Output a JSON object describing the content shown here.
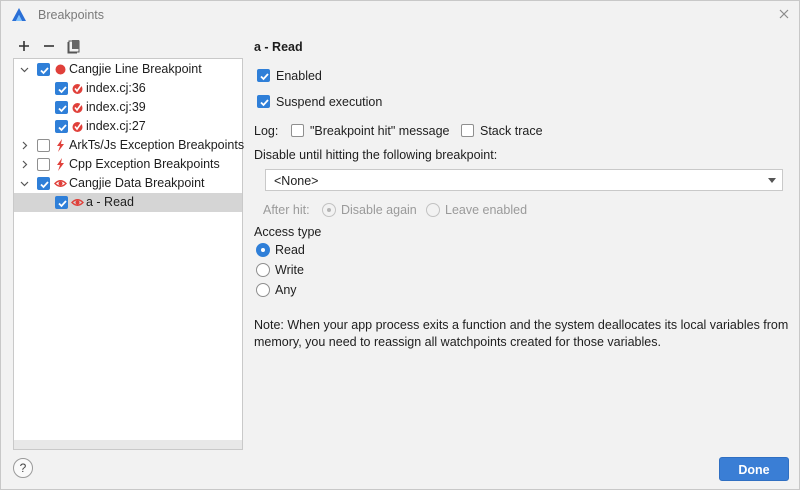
{
  "window": {
    "title": "Breakpoints",
    "logo_icon": "deveco-logo-icon",
    "close_icon": "close-icon"
  },
  "toolbar": {
    "add_icon": "plus-icon",
    "remove_icon": "minus-icon",
    "group_icon": "group-icon"
  },
  "tree": {
    "items": [
      {
        "label": "Cangjie Line Breakpoint",
        "checked": true,
        "icon": "red-dot-icon",
        "expanded": true
      },
      {
        "label": "index.cj:36",
        "checked": true,
        "icon": "line-breakpoint-icon"
      },
      {
        "label": "index.cj:39",
        "checked": true,
        "icon": "line-breakpoint-icon"
      },
      {
        "label": "index.cj:27",
        "checked": true,
        "icon": "line-breakpoint-icon"
      },
      {
        "label": "ArkTs/Js Exception Breakpoints",
        "checked": false,
        "icon": "lightning-icon",
        "expanded": false
      },
      {
        "label": "Cpp Exception Breakpoints",
        "checked": false,
        "icon": "lightning-icon",
        "expanded": false
      },
      {
        "label": "Cangjie Data Breakpoint",
        "checked": true,
        "icon": "eye-icon",
        "expanded": true
      },
      {
        "label": "a - Read",
        "checked": true,
        "icon": "eye-icon",
        "selected": true
      }
    ]
  },
  "detail": {
    "heading": "a - Read",
    "enabled_label": "Enabled",
    "enabled": true,
    "suspend_label": "Suspend execution",
    "suspend": true,
    "log_label": "Log:",
    "log_message_label": "\"Breakpoint hit\" message",
    "log_message": false,
    "stack_trace_label": "Stack trace",
    "stack_trace": false,
    "disable_until_label": "Disable until hitting the following breakpoint:",
    "disable_until_value": "<None>",
    "after_hit_label": "After hit:",
    "disable_again_label": "Disable again",
    "leave_enabled_label": "Leave enabled",
    "access_type_label": "Access type",
    "access_options": [
      "Read",
      "Write",
      "Any"
    ],
    "access_selected": "Read",
    "note": "Note: When your app process exits a function and the system deallocates its local variables from memory, you need to reassign all watchpoints created for those variables."
  },
  "footer": {
    "help_label": "?",
    "done_label": "Done"
  },
  "colors": {
    "accent": "#2f7fd8",
    "done_button": "#3a7ed5",
    "breakpoint_red": "#e0403a"
  }
}
